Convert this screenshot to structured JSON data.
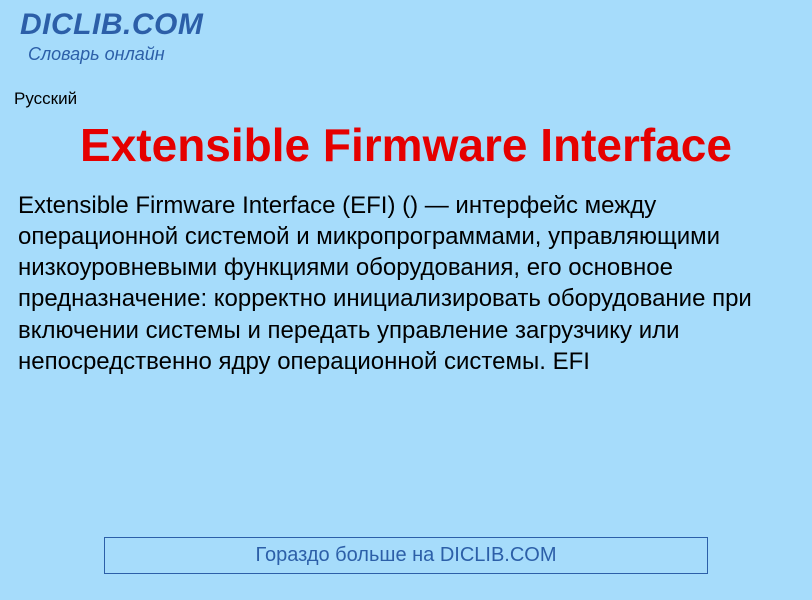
{
  "header": {
    "site_title": "DICLIB.COM",
    "site_subtitle": "Словарь онлайн"
  },
  "lang": {
    "label": "Русский"
  },
  "article": {
    "title": "Extensible Firmware Interface",
    "body": "Extensible Firmware Interface (EFI) () — интерфейс между операционной системой и микропрограммами, управляющими низкоуровневыми функциями оборудования, его основное предназначение: корректно инициализировать оборудование при включении системы и передать управление загрузчику или непосредственно ядру операционной системы. EFI"
  },
  "more": {
    "label": "Гораздо больше на DICLIB.COM"
  }
}
